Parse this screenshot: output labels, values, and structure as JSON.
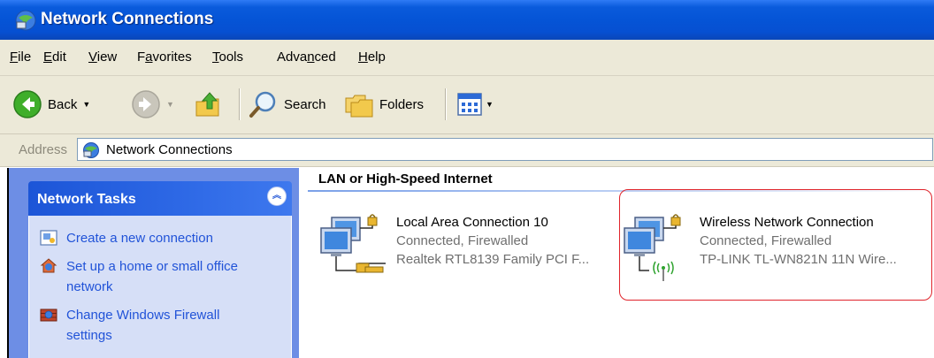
{
  "window": {
    "title": "Network Connections",
    "icon": "network-connections-icon"
  },
  "menu": [
    {
      "pre": "",
      "mn": "F",
      "post": "ile"
    },
    {
      "pre": "",
      "mn": "E",
      "post": "dit"
    },
    {
      "pre": "",
      "mn": "V",
      "post": "iew"
    },
    {
      "pre": "F",
      "mn": "a",
      "post": "vorites"
    },
    {
      "pre": "",
      "mn": "T",
      "post": "ools"
    },
    {
      "pre": "Adva",
      "mn": "n",
      "post": "ced"
    },
    {
      "pre": "",
      "mn": "H",
      "post": "elp"
    }
  ],
  "toolbar": {
    "back_label": "Back",
    "search_label": "Search",
    "folders_label": "Folders",
    "icons": [
      "back-arrow-icon",
      "forward-arrow-icon",
      "up-folder-icon",
      "search-magnifier-icon",
      "folders-icon",
      "views-icon"
    ]
  },
  "address": {
    "label": "Address",
    "value": "Network Connections"
  },
  "tasks": {
    "title": "Network Tasks",
    "items": [
      {
        "label": "Create a new connection",
        "icon": "new-connection-icon"
      },
      {
        "label": "Set up a home or small office network",
        "icon": "home-network-icon"
      },
      {
        "label": "Change Windows Firewall settings",
        "icon": "firewall-icon"
      }
    ]
  },
  "group": {
    "title": "LAN or High-Speed Internet"
  },
  "connections": [
    {
      "name": "Local Area Connection 10",
      "status": "Connected, Firewalled",
      "device": "Realtek RTL8139 Family PCI F...",
      "icon": "lan-connection-icon"
    },
    {
      "name": "Wireless Network Connection",
      "status": "Connected, Firewalled",
      "device": "TP-LINK TL-WN821N 11N Wire...",
      "icon": "wireless-connection-icon"
    }
  ],
  "colors": {
    "titlebar": "#0554d6",
    "chrome": "#ece9d8",
    "tasks_bg": "#6d8ee5",
    "task_link": "#2153d8",
    "highlight": "#e0242b"
  }
}
